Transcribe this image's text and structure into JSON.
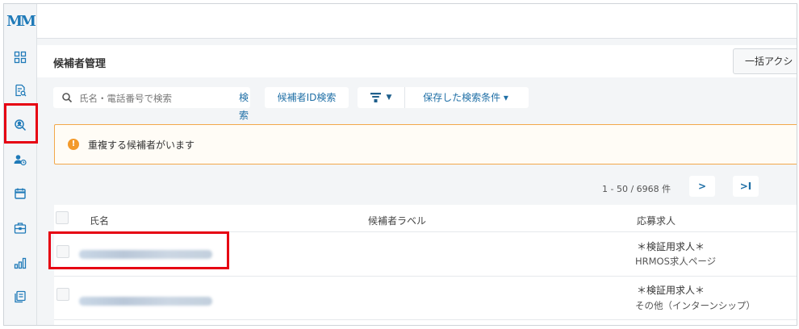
{
  "app": {
    "logo_text": "M"
  },
  "sidebar": {
    "icons": [
      "dashboard-icon",
      "document-search-icon",
      "candidate-search-icon",
      "candidate-schedule-icon",
      "calendar-icon",
      "job-icon",
      "analytics-icon",
      "report-icon"
    ],
    "active": "candidate-search-icon"
  },
  "page": {
    "title": "候補者管理",
    "bulk_action_label": "一括アクシ"
  },
  "search": {
    "placeholder": "氏名・電話番号で検索",
    "value": "",
    "button_label": "検索"
  },
  "toolbar": {
    "id_search_label": "候補者ID検索",
    "saved_search_label": "保存した検索条件 ▾",
    "filter_caret": "▼"
  },
  "alert": {
    "text": "重複する候補者がいます",
    "icon_glyph": "!"
  },
  "pagination": {
    "summary": "1 -  50 / 6968 件",
    "next_label": ">",
    "last_label": ">I"
  },
  "table": {
    "headers": {
      "name": "氏名",
      "label": "候補者ラベル",
      "job": "応募求人"
    },
    "rows": [
      {
        "name": "",
        "label": "",
        "job_title": "＊検証用求人＊",
        "job_source": "HRMOS求人ページ"
      },
      {
        "name": "",
        "label": "",
        "job_title": "＊検証用求人＊",
        "job_source": "その他（インターンシップ）"
      }
    ]
  },
  "colors": {
    "accent": "#1f7ab8",
    "highlight": "#e60012",
    "alert_border": "#f2a84a",
    "alert_icon": "#f39a2b"
  }
}
